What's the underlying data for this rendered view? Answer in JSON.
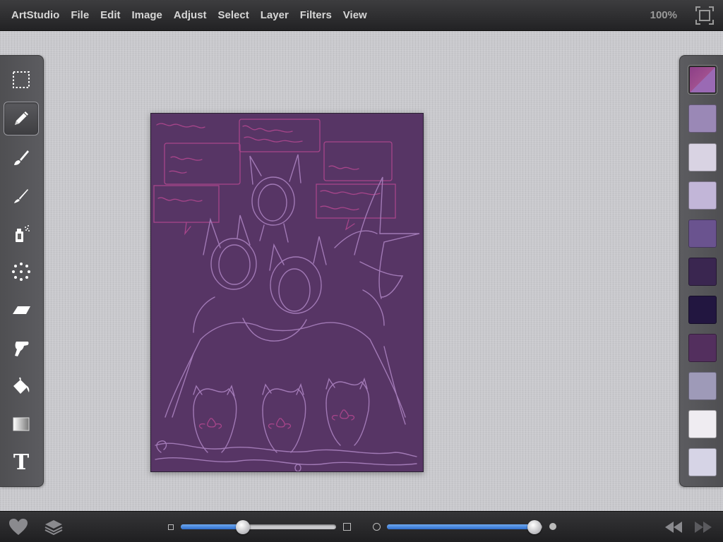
{
  "menubar": {
    "items": [
      {
        "label": "ArtStudio"
      },
      {
        "label": "File"
      },
      {
        "label": "Edit"
      },
      {
        "label": "Image"
      },
      {
        "label": "Adjust"
      },
      {
        "label": "Select"
      },
      {
        "label": "Layer"
      },
      {
        "label": "Filters"
      },
      {
        "label": "View"
      }
    ],
    "zoom": "100%"
  },
  "tools": [
    {
      "name": "selection-tool",
      "icon": "dashed-rectangle-icon",
      "active": false
    },
    {
      "name": "pencil-tool",
      "icon": "pencil-icon",
      "active": true
    },
    {
      "name": "brush-tool",
      "icon": "paintbrush-icon",
      "active": false
    },
    {
      "name": "smudge-brush-tool",
      "icon": "thin-brush-icon",
      "active": false
    },
    {
      "name": "spray-tool",
      "icon": "spray-can-icon",
      "active": false
    },
    {
      "name": "scatter-tool",
      "icon": "dots-circle-icon",
      "active": false
    },
    {
      "name": "eraser-tool",
      "icon": "eraser-icon",
      "active": false
    },
    {
      "name": "smudge-tool",
      "icon": "finger-icon",
      "active": false
    },
    {
      "name": "fill-tool",
      "icon": "paint-bucket-icon",
      "active": false
    },
    {
      "name": "gradient-tool",
      "icon": "gradient-icon",
      "active": false
    },
    {
      "name": "text-tool",
      "icon": "text-icon",
      "label": "T",
      "active": false
    }
  ],
  "swatches": [
    {
      "color": "#8e4a8f",
      "selected": true
    },
    {
      "color": "#9a88b6"
    },
    {
      "color": "#d9d3e3"
    },
    {
      "color": "#c2b6d8"
    },
    {
      "color": "#6a538f"
    },
    {
      "color": "#3a2650"
    },
    {
      "color": "#221640"
    },
    {
      "color": "#532f5e"
    },
    {
      "color": "#9e9ab8"
    },
    {
      "color": "#efecf1"
    },
    {
      "color": "#d6d4e6"
    }
  ],
  "canvas": {
    "background": "#573565",
    "sketch_color": "#a57dba",
    "text_sketch_color": "#b0478f"
  },
  "bottombar": {
    "brush_size_fraction": 0.4,
    "opacity_fraction": 0.95,
    "icons": [
      "heart-icon",
      "layers-icon",
      "small-square-icon",
      "large-square-icon",
      "small-circle-icon",
      "large-circle-icon",
      "undo-icon",
      "redo-icon"
    ]
  }
}
